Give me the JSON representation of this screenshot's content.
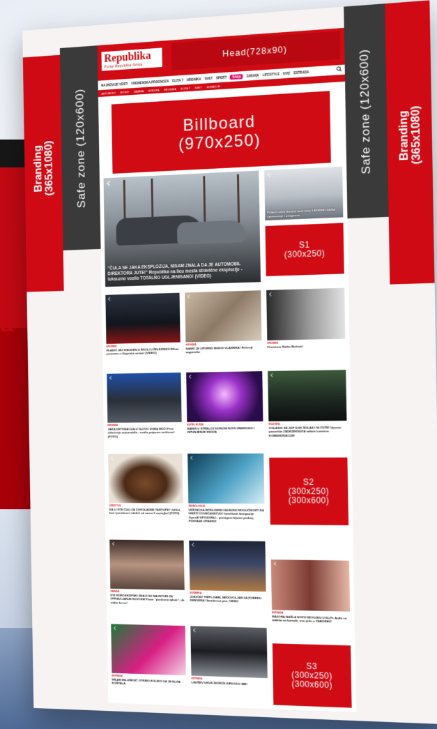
{
  "mockup": {
    "branding_left": "Branding\n(365x1080)",
    "safe_left": "Safe zone (120x600)",
    "safe_right": "Safe zone (120x600)",
    "branding_right": "Branding\n(365x1080)"
  },
  "site": {
    "logo": "Republika",
    "logo_sub": "Portal Republika Srbija",
    "head_ad": "Head(728x90)",
    "nav": [
      "NAJNOVIJE VESTI",
      "VREMENSKA PROGNOZA",
      "ELITA 7",
      "HRONIKA",
      "SVET",
      "SPORT",
      "ZABAVA",
      "LIFESTYLE",
      "KVIZ",
      "ESTRADA"
    ],
    "nav_highlight": "Srbija",
    "subnav": [
      "AKTUELNO",
      "SPORT",
      "ZABAVA",
      "EVROPA",
      "HRONIKA",
      "ELITA 7",
      "SVET",
      "ZDRAVLJE"
    ],
    "billboard": "Billboard\n(970x250)",
    "hero_caption": "\"ČULA SE JAKA EKSPLOZIJA, NISAM ZNALA DA JE AUTOMOBIL DIREKTORA JUTE!\" Republika na licu mesta stravične eksplozije - luksuzno vozilo TOTALNO UGLJENISANO! (VIDEO)",
    "side_caption": "Polarni vetar donosi novi talas LEDENIH DANA - upozorenje i prognoza",
    "ads": {
      "s1": "S1\n(300x250)",
      "s2": "S2\n(300x250)\n(300x600)",
      "s3": "S3\n(300x250)\n(300x600)"
    },
    "cards": [
      {
        "cat": "HRONIKA",
        "title": "HLADIĆ JEJ IZBODEN U ŠKOLI U ŽELEZNIKU Mihan prevezen u Urgentni centar! (VIDEO)"
      },
      {
        "cat": "HRONIKA",
        "title": "NASKI JE UPORNO BUDIO VLASNIKA! Rešenje zagonetke"
      },
      {
        "cat": "HRONIKA",
        "title": "Preminuo Ratko Božović"
      },
      {
        "cat": "HRONIKA",
        "title": "JAKA DETONACIJA U GLUVO DOBA NOĆI Prvo oštećenje automobila - vozilo potpuno uništeno! (FOTO)"
      },
      {
        "cat": "ASTRO KUTAK",
        "title": "NAMIS U STRELCU DONOSI NOVU ENERGIJU I ISPUNJENJE SNOVA"
      },
      {
        "cat": "KULTURA",
        "title": "OGLASIO SE JOP DOK ŠOLAK I NI ĆUTE! Uprava pozorišta ZADEZEKNUTA nakon Lovćevo KOMEMORACIJE!"
      },
      {
        "cat": "LIFESTYLE",
        "title": "DA LI STE ČULI ZA ČOKOLADNE TARTUFE? Jeftini, lasi i preukusni slatkiš od samo 3 sastojka! (FOTO)"
      },
      {
        "cat": "TEHNOLOGIJA",
        "title": "VEŠTAČKA INTELIGENCIJA BUDU MOGUĆNOSTI DA UNIŠTI ČOVEČANSTVO! Istraživači kompanije OpenAI UPOZORILI - postignut ključni proboj, POSTAJE OPASNO!"
      },
      {
        "cat": "ZABAVA",
        "title": "DVI HOROSKOPSKI ZNACI SU MAJSTORI ZA UPRAVLJANJE NOVCEM Prave \"poslovne ajkule\", da vidite ko su!"
      },
      {
        "cat": "KOŠARKA",
        "title": "JOKIĆEV TRIPL DABL NEDOVOLJAN ZA POBEDU DENVERA! Samberica pao, VIDEO"
      },
      {
        "cat": "ESTRADA",
        "title": "MAJORA NAŠLA NOVU DEVOJKU U ELITI. Anđa se zbližila na koreale, ovo jedu u ZABORAV!"
      },
      {
        "cat": "ESTRADA",
        "title": "MILAN MILOŠEVIĆ OTKRIO KOLIKO GA JE ELITA KOŠTALA"
      },
      {
        "cat": "ESTRADA",
        "title": "LAUŠEV UKUK MOŠIĆE KIRGOVO IME!"
      }
    ]
  },
  "colors": {
    "brand_red": "#d10b14",
    "dark_zone": "#3a3a3a",
    "highlight_pink": "#e30a6c"
  }
}
